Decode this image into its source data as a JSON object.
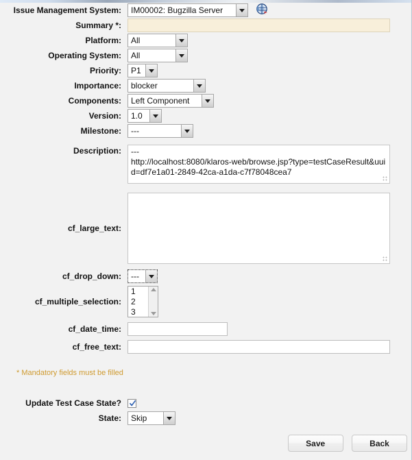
{
  "form": {
    "fields": [
      {
        "label": "Issue Management System:",
        "type": "select",
        "value": "IM00002: Bugzilla Server"
      },
      {
        "label": "Summary *:",
        "type": "text",
        "value": "",
        "placeholder": ""
      },
      {
        "label": "Platform:",
        "type": "select",
        "value": "All"
      },
      {
        "label": "Operating System:",
        "type": "select",
        "value": "All"
      },
      {
        "label": "Priority:",
        "type": "select",
        "value": "P1"
      },
      {
        "label": "Importance:",
        "type": "select",
        "value": "blocker"
      },
      {
        "label": "Components:",
        "type": "select",
        "value": "Left Component"
      },
      {
        "label": "Version:",
        "type": "select",
        "value": "1.0"
      },
      {
        "label": "Milestone:",
        "type": "select",
        "value": "---"
      },
      {
        "label": "Description:",
        "type": "textarea",
        "value": "---\nhttp://localhost:8080/klaros-web/browse.jsp?type=testCaseResult&uuid=df7e1a01-2849-42ca-a1da-c7f78048cea7"
      },
      {
        "label": "cf_large_text:",
        "type": "textarea",
        "value": ""
      },
      {
        "label": "cf_drop_down:",
        "type": "select",
        "value": "---"
      },
      {
        "label": "cf_multiple_selection:",
        "type": "listbox",
        "options": [
          "1",
          "2",
          "3"
        ]
      },
      {
        "label": "cf_date_time:",
        "type": "text",
        "value": "",
        "placeholder": ""
      },
      {
        "label": "cf_free_text:",
        "type": "text",
        "value": "",
        "placeholder": ""
      }
    ],
    "mandatory_note": "* Mandatory fields must be filled",
    "update_state": {
      "label": "Update Test Case State?",
      "checked": true
    },
    "state": {
      "label": "State:",
      "value": "Skip"
    }
  },
  "icons": {
    "ims_link": "globe-icon"
  },
  "buttons": {
    "save": "Save",
    "back": "Back"
  },
  "colors": {
    "background": "#f2f2f2",
    "mandatory": "#cf9a2f",
    "summary_field": "#f8efda",
    "accent": "#b9c4d2"
  }
}
